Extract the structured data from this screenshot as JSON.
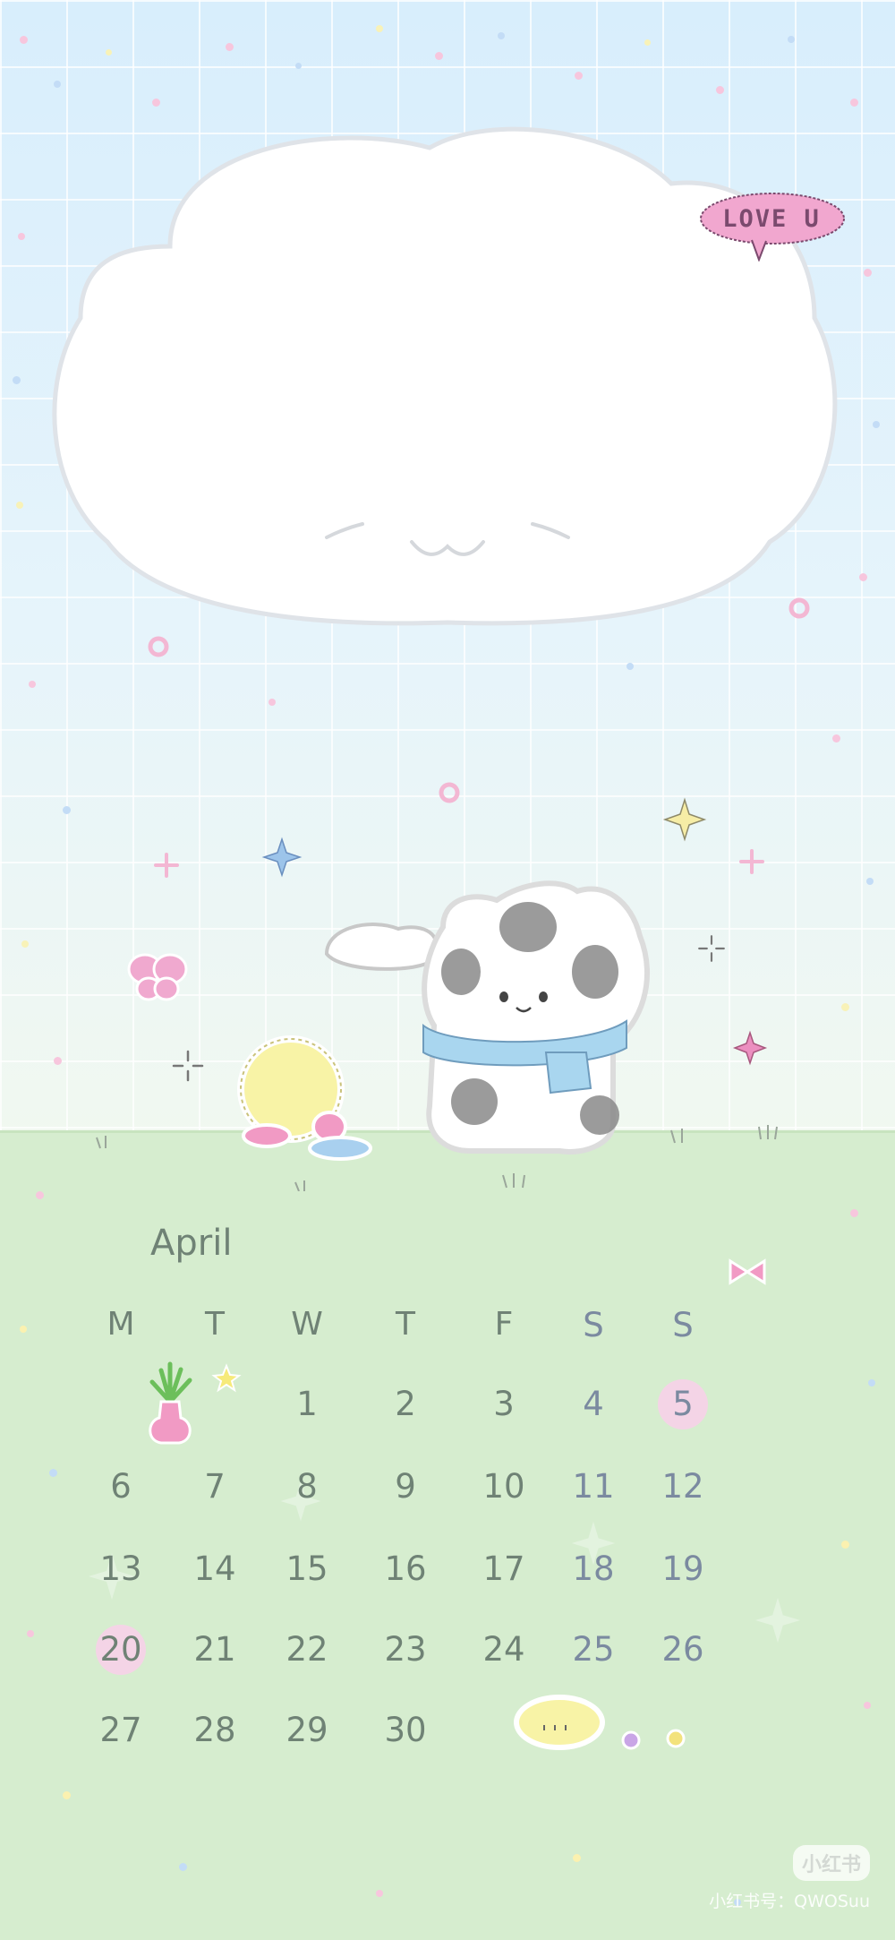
{
  "speech_bubble": "LOVE U",
  "calendar": {
    "month": "April",
    "weekdays": [
      "M",
      "T",
      "W",
      "T",
      "F",
      "S",
      "S"
    ],
    "days": [
      "1",
      "2",
      "3",
      "4",
      "5",
      "6",
      "7",
      "8",
      "9",
      "10",
      "11",
      "12",
      "13",
      "14",
      "15",
      "16",
      "17",
      "18",
      "19",
      "20",
      "21",
      "22",
      "23",
      "24",
      "25",
      "26",
      "27",
      "28",
      "29",
      "30"
    ],
    "highlighted_days": [
      "5",
      "20"
    ]
  },
  "watermark": {
    "logo": "小红书",
    "id_line": "小红书号：QWOSuu"
  },
  "colors": {
    "sky": "#e3f3fc",
    "grass": "#d6edcf",
    "text": "#6f8275",
    "weekend_text": "#7b8aa0",
    "highlight": "#f4d4e6",
    "bubble": "#f1a7cf",
    "scarf": "#a9d6ef"
  }
}
